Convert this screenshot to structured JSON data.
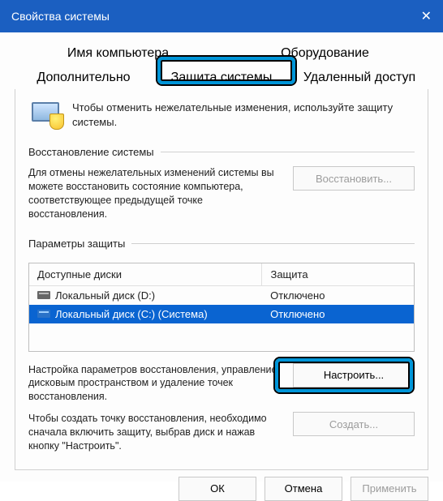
{
  "title": "Свойства системы",
  "tabs": {
    "row1": [
      "Имя компьютера",
      "Оборудование"
    ],
    "row2": [
      "Дополнительно",
      "Защита системы",
      "Удаленный доступ"
    ],
    "active": "Защита системы"
  },
  "intro": "Чтобы отменить нежелательные изменения, используйте защиту системы.",
  "groups": {
    "restore": {
      "label": "Восстановление системы",
      "text": "Для отмены нежелательных изменений системы вы можете восстановить состояние компьютера, соответствующее предыдущей точке восстановления.",
      "button": "Восстановить..."
    },
    "protection": {
      "label": "Параметры защиты",
      "columns": {
        "name": "Доступные диски",
        "prot": "Защита"
      },
      "drives": [
        {
          "name": "Локальный диск (D:)",
          "prot": "Отключено",
          "selected": false,
          "icon": "dark"
        },
        {
          "name": "Локальный диск (C:) (Система)",
          "prot": "Отключено",
          "selected": true,
          "icon": "blue"
        }
      ],
      "config": {
        "text": "Настройка параметров восстановления, управление дисковым пространством и удаление точек восстановления.",
        "button": "Настроить..."
      },
      "create": {
        "text": "Чтобы создать точку восстановления, необходимо сначала включить защиту, выбрав диск и нажав кнопку \"Настроить\".",
        "button": "Создать..."
      }
    }
  },
  "footer": {
    "ok": "ОК",
    "cancel": "Отмена",
    "apply": "Применить"
  }
}
